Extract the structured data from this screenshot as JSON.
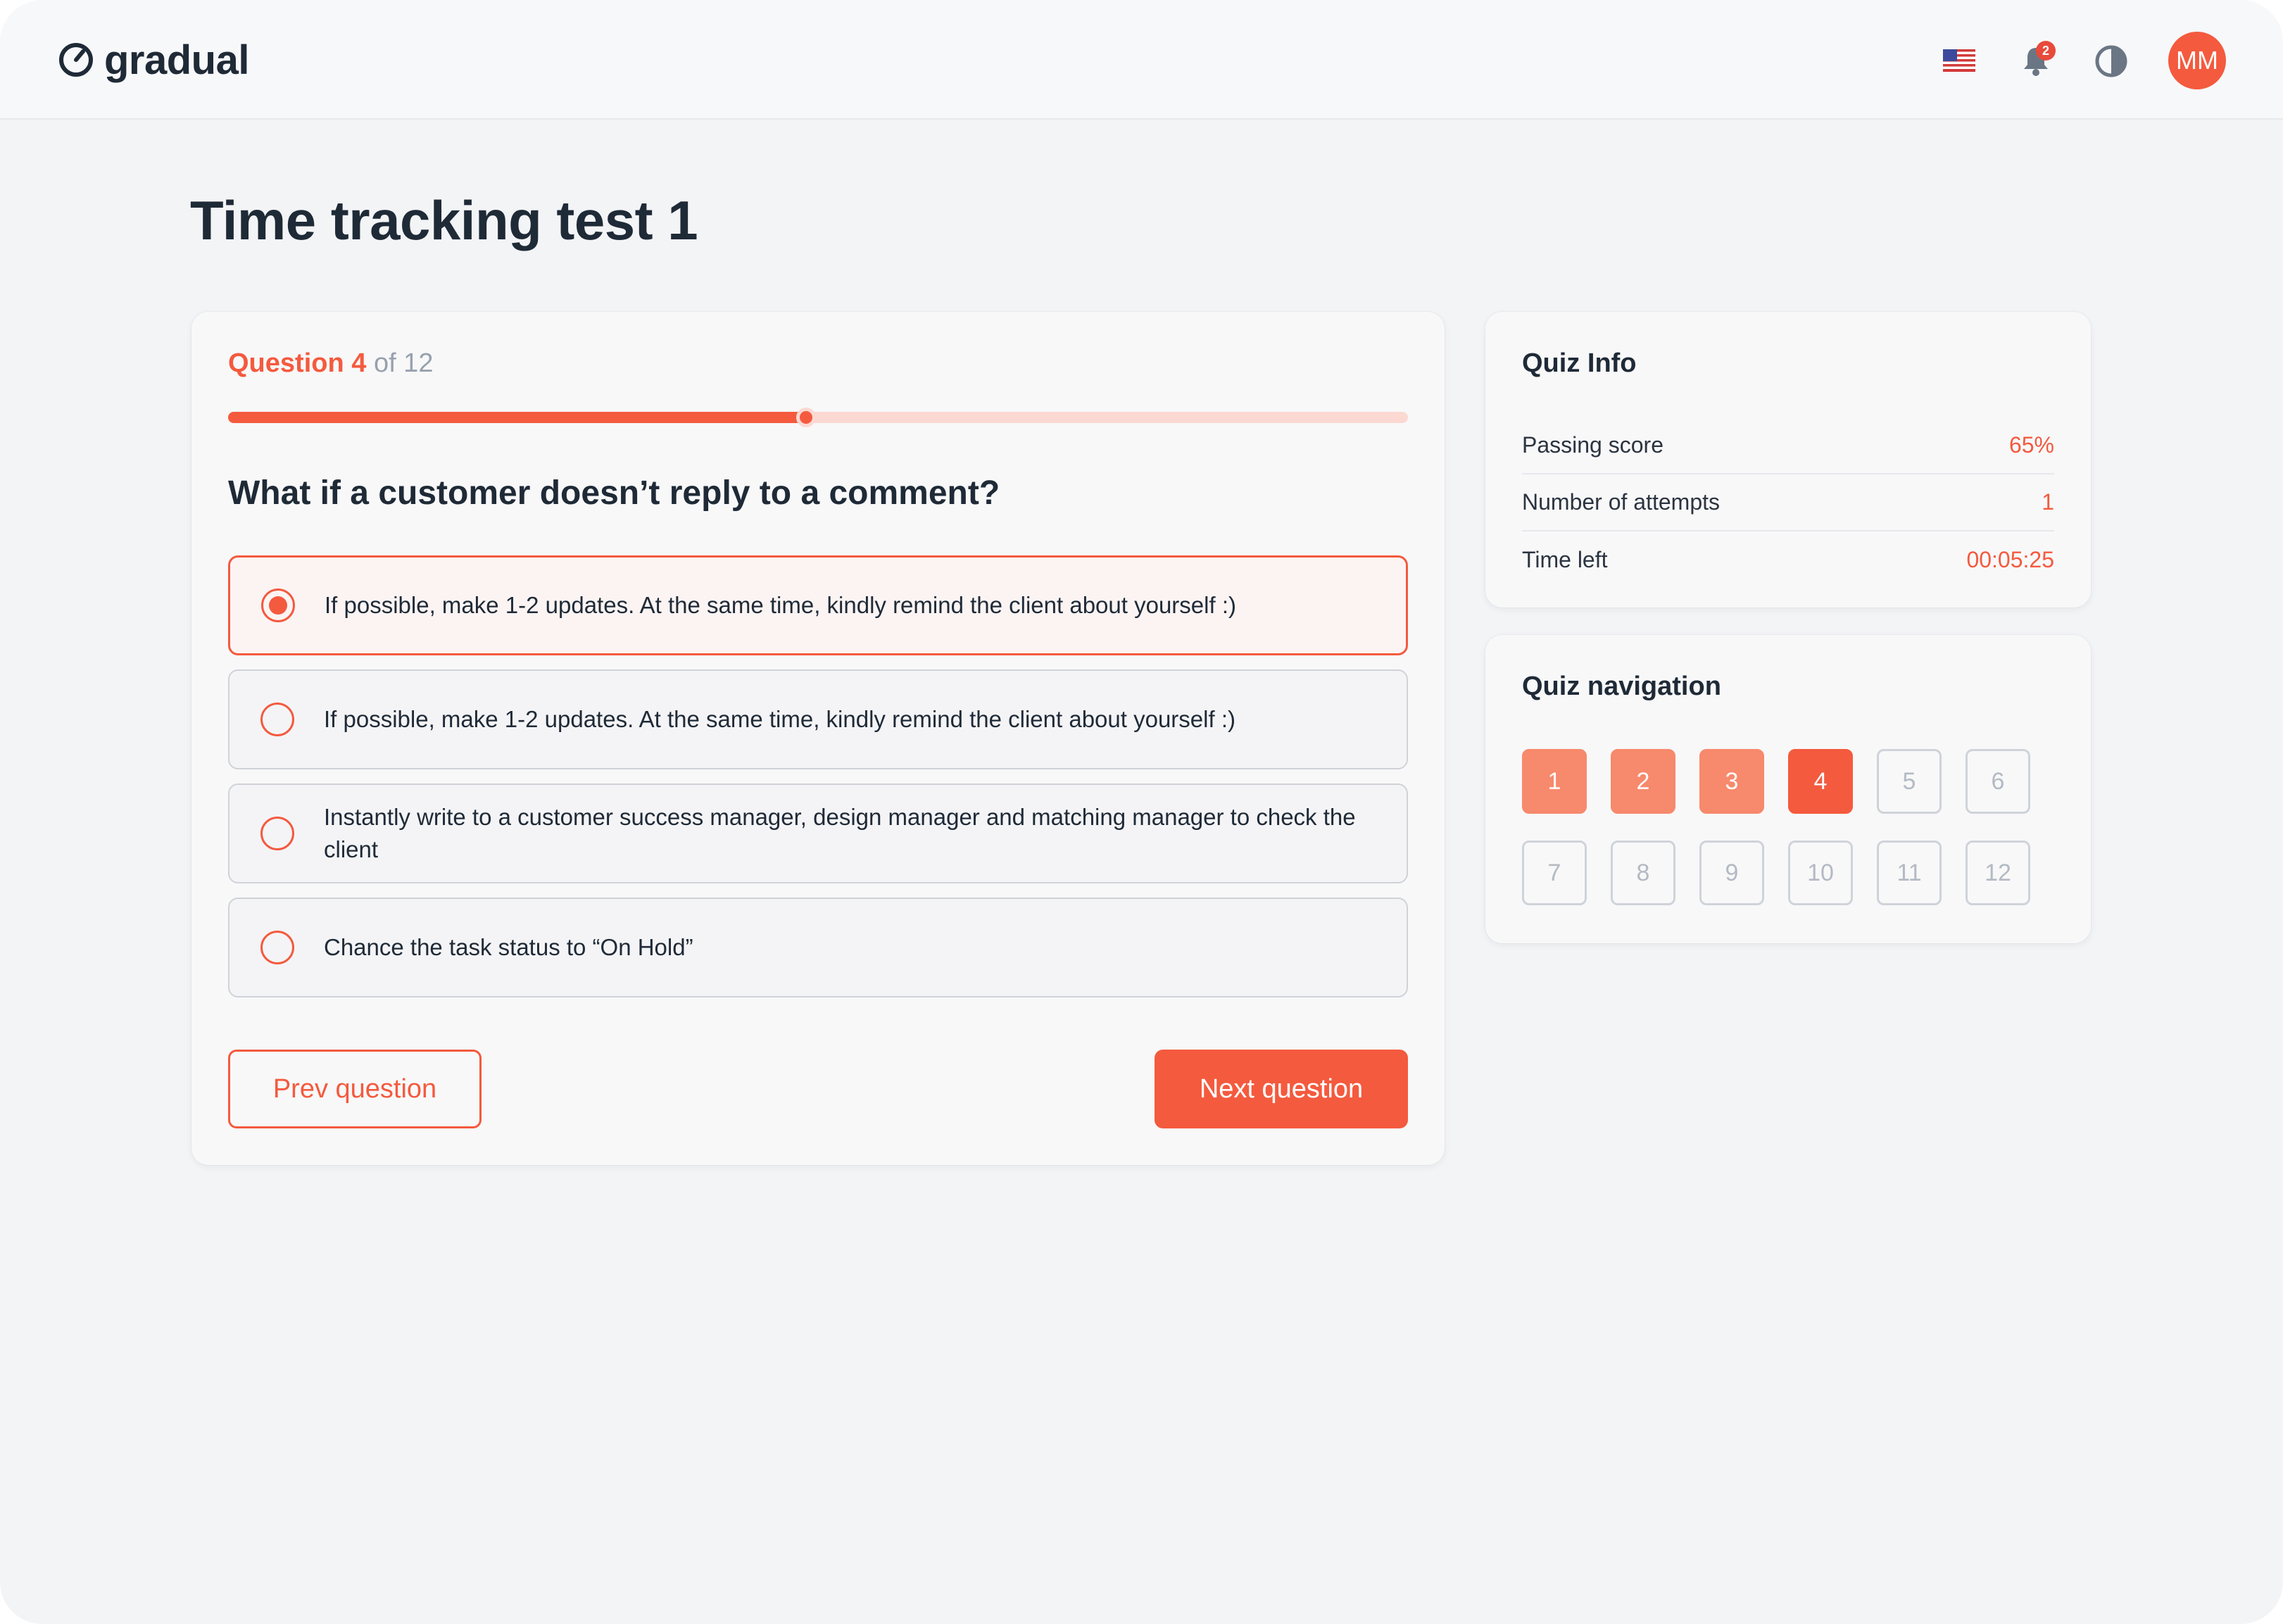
{
  "app": {
    "name": "gradual",
    "notification_count": "2",
    "user_initials": "MM",
    "language_icon": "us-flag-icon",
    "accent_color": "#f45a3e"
  },
  "page": {
    "title": "Time tracking test 1"
  },
  "quiz": {
    "question_label": "Question 4",
    "question_total": "of 12",
    "progress_fraction": 0.49,
    "question_text": "What if a customer doesn’t reply to a comment?",
    "options": [
      {
        "text": "If possible, make 1-2 updates. At the same time, kindly remind the client about yourself :)",
        "selected": true
      },
      {
        "text": "If possible, make 1-2 updates. At the same time, kindly remind the client about yourself :)",
        "selected": false
      },
      {
        "text": "Instantly write to a customer success manager, design manager and matching manager to check the client",
        "selected": false
      },
      {
        "text": "Chance the task status to “On Hold”",
        "selected": false
      }
    ],
    "prev_label": "Prev question",
    "next_label": "Next question"
  },
  "info": {
    "title": "Quiz Info",
    "rows": [
      {
        "label": "Passing score",
        "value": "65%"
      },
      {
        "label": "Number of attempts",
        "value": "1"
      },
      {
        "label": "Time left",
        "value": "00:05:25"
      }
    ]
  },
  "navigation": {
    "title": "Quiz navigation",
    "items": [
      {
        "label": "1",
        "state": "done"
      },
      {
        "label": "2",
        "state": "done"
      },
      {
        "label": "3",
        "state": "done"
      },
      {
        "label": "4",
        "state": "current"
      },
      {
        "label": "5",
        "state": "todo"
      },
      {
        "label": "6",
        "state": "todo"
      },
      {
        "label": "7",
        "state": "todo"
      },
      {
        "label": "8",
        "state": "todo"
      },
      {
        "label": "9",
        "state": "todo"
      },
      {
        "label": "10",
        "state": "todo"
      },
      {
        "label": "11",
        "state": "todo"
      },
      {
        "label": "12",
        "state": "todo"
      }
    ]
  }
}
